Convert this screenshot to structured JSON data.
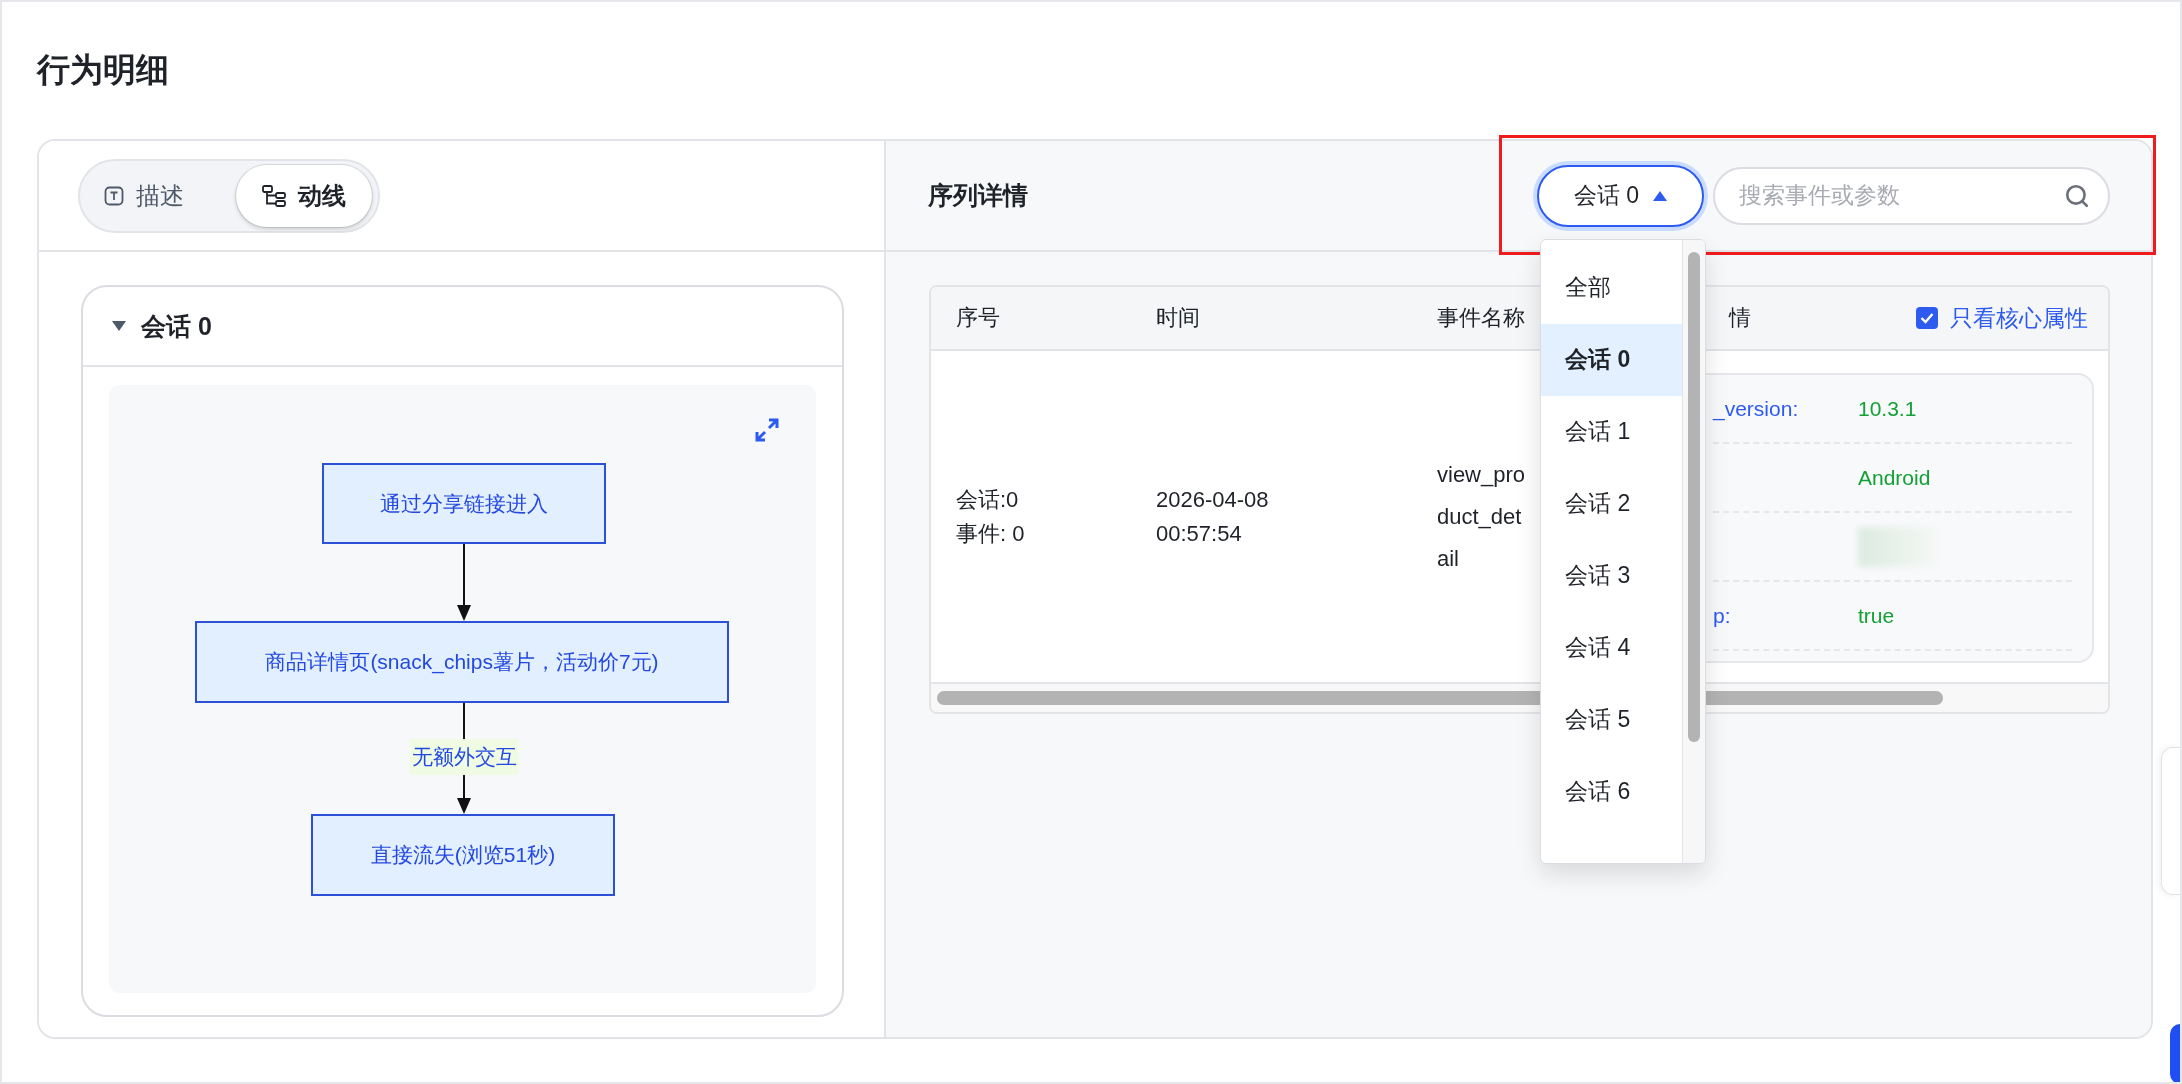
{
  "page_title": "行为明细",
  "view_tabs": [
    {
      "label": "描述",
      "kind": "text",
      "selected": false
    },
    {
      "label": "动线",
      "kind": "flow",
      "selected": true
    }
  ],
  "session_card": {
    "title": "会话 0",
    "expanded": true,
    "flow": {
      "nodes": [
        {
          "label": "通过分享链接进入"
        },
        {
          "label": "商品详情页(snack_chips薯片，活动价7元)",
          "next_edge_label": "无额外交互"
        },
        {
          "label": "直接流失(浏览51秒)"
        }
      ]
    }
  },
  "sequence_panel": {
    "title": "序列详情",
    "session_select": {
      "value": "会话 0",
      "open": true,
      "options": [
        {
          "label": "全部",
          "selected": false
        },
        {
          "label": "会话 0",
          "selected": true
        },
        {
          "label": "会话 1",
          "selected": false
        },
        {
          "label": "会话 2",
          "selected": false
        },
        {
          "label": "会话 3",
          "selected": false
        },
        {
          "label": "会话 4",
          "selected": false
        },
        {
          "label": "会话 5",
          "selected": false
        },
        {
          "label": "会话 6",
          "selected": false
        }
      ]
    },
    "search": {
      "placeholder": "搜索事件或参数"
    },
    "table": {
      "columns": [
        "序号",
        "时间",
        "事件名称",
        "情"
      ],
      "core_only": {
        "label": "只看核心属性",
        "checked": true
      },
      "rows": [
        {
          "seq": "会话:0\n事件: 0",
          "time": "2026-04-08\n00:57:54",
          "event": "view_product_detail",
          "details": [
            {
              "kind": "text",
              "key": "_version:",
              "value": "10.3.1"
            },
            {
              "kind": "text",
              "value": "Android"
            },
            {
              "kind": "blurred"
            },
            {
              "kind": "text",
              "key": "p:",
              "value": "true"
            }
          ]
        }
      ]
    }
  }
}
